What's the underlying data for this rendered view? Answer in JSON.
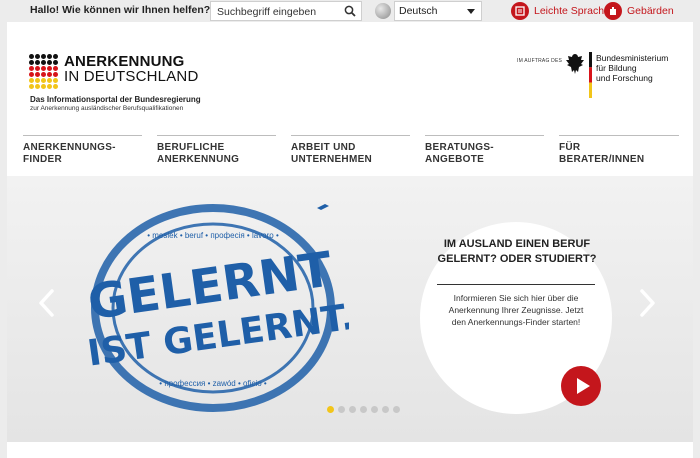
{
  "topbar": {
    "greeting": "Hallo! Wie können wir Ihnen helfen?",
    "search_placeholder": "Suchbegriff eingeben",
    "language_selected": "Deutsch",
    "easy_language": "Leichte Sprache",
    "sign_language": "Gebärden"
  },
  "logo": {
    "title_line1": "ANERKENNUNG",
    "title_line2": "IN DEUTSCHLAND",
    "subtitle1": "Das Informationsportal der Bundesregierung",
    "subtitle2": "zur Anerkennung ausländischer Berufsqualifikationen"
  },
  "ministry": {
    "on_behalf": "IM AUFTRAG DES",
    "name_line1": "Bundesministerium",
    "name_line2": "für Bildung",
    "name_line3": "und Forschung"
  },
  "nav": [
    {
      "line1": "ANERKENNUNGS-",
      "line2": "FINDER"
    },
    {
      "line1": "BERUFLICHE",
      "line2": "ANERKENNUNG"
    },
    {
      "line1": "ARBEIT UND",
      "line2": "UNTERNEHMEN"
    },
    {
      "line1": "BERATUNGS-",
      "line2": "ANGEBOTE"
    },
    {
      "line1": "FÜR",
      "line2": "BERATER/INNEN"
    }
  ],
  "hero": {
    "stamp_line1": "GELERNT",
    "stamp_line2": "IST GELERNT.",
    "ring_words": "• meslek • beruf • професія • lavoro •",
    "ring_words_bottom": "• профессия • zawód • oficio • ",
    "title_line1": "IM AUSLAND EINEN BERUF",
    "title_line2": "GELERNT? ODER STUDIERT?",
    "text_line1": "Informieren Sie sich hier über die",
    "text_line2": "Anerkennung Ihrer Zeugnisse. Jetzt",
    "text_line3": "den Anerkennungs-Finder starten!",
    "active_slide": 1,
    "slide_count": 7
  },
  "colors": {
    "accent_red": "#c4161c",
    "stamp_blue": "#1f5fa8",
    "dot_active": "#f2c51a"
  },
  "icons": {
    "search": "search-icon",
    "globe": "globe-icon",
    "easy_language": "easy-language-icon",
    "sign_language": "sign-language-icon",
    "prev": "chevron-left-icon",
    "next": "chevron-right-icon",
    "play": "play-icon"
  }
}
